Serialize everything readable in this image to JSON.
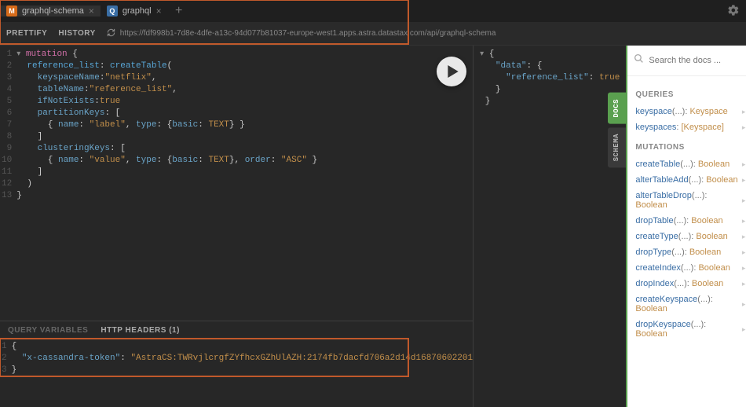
{
  "tabs": [
    {
      "label": "graphql-schema",
      "badge": "M",
      "active": true
    },
    {
      "label": "graphql",
      "badge": "Q",
      "active": false
    }
  ],
  "gear_icon": "gear",
  "toolbar": {
    "prettify": "PRETTIFY",
    "history": "HISTORY",
    "url": "https://fdf998b1-7d8e-4dfe-a13c-94d077b81037-europe-west1.apps.astra.datastax.com/api/graphql-schema"
  },
  "editor": {
    "lines": [
      {
        "n": 1,
        "html": "<span class='caret'>▾</span> <span class='kw'>mutation</span> {"
      },
      {
        "n": 2,
        "html": "  <span class='field'>reference_list</span>: <span class='field'>createTable</span>("
      },
      {
        "n": 3,
        "html": "    <span class='prop'>keyspaceName</span>:<span class='str'>\"netflix\"</span>,"
      },
      {
        "n": 4,
        "html": "    <span class='prop'>tableName</span>:<span class='str'>\"reference_list\"</span>,"
      },
      {
        "n": 5,
        "html": "    <span class='prop'>ifNotExists</span>:<span class='bool'>true</span>"
      },
      {
        "n": 6,
        "html": "    <span class='prop'>partitionKeys</span>: ["
      },
      {
        "n": 7,
        "html": "      { <span class='prop'>name</span>: <span class='str'>\"label\"</span>, <span class='prop'>type</span>: {<span class='prop'>basic</span>: <span class='enum'>TEXT</span>} }"
      },
      {
        "n": 8,
        "html": "    ]"
      },
      {
        "n": 9,
        "html": "    <span class='prop'>clusteringKeys</span>: ["
      },
      {
        "n": 10,
        "html": "      { <span class='prop'>name</span>: <span class='str'>\"value\"</span>, <span class='prop'>type</span>: {<span class='prop'>basic</span>: <span class='enum'>TEXT</span>}, <span class='prop'>order</span>: <span class='str'>\"ASC\"</span> }"
      },
      {
        "n": 11,
        "html": "    ]"
      },
      {
        "n": 12,
        "html": "  )"
      },
      {
        "n": 13,
        "html": "}"
      }
    ]
  },
  "result": {
    "lines": [
      "<span class='caret'>▾</span> {",
      "   <span class='prop'>\"data\"</span>: {",
      "     <span class='prop'>\"reference_list\"</span>: <span class='bool'>true</span>",
      "   }",
      " }"
    ]
  },
  "vars": {
    "tab_query": "QUERY VARIABLES",
    "tab_headers": "HTTP HEADERS (1)",
    "lines": [
      {
        "n": 1,
        "html": "{"
      },
      {
        "n": 2,
        "html": "  <span class='prop'>\"x-cassandra-token\"</span>: <span class='str'>\"AstraCS:TWRvjlcrgfZYfhcxGZhUlAZH:2174fb7dacfd706a2d14d16870602201</span>"
      },
      {
        "n": 3,
        "html": "}"
      }
    ]
  },
  "side": {
    "docs": "DOCS",
    "schema": "SCHEMA"
  },
  "docs": {
    "search_placeholder": "Search the docs ...",
    "sections": [
      {
        "title": "QUERIES",
        "items": [
          {
            "name": "keyspace",
            "args": "(...)",
            "type": "Keyspace"
          },
          {
            "name": "keyspaces",
            "args": "",
            "type": "[Keyspace]"
          }
        ]
      },
      {
        "title": "MUTATIONS",
        "items": [
          {
            "name": "createTable",
            "args": "(...)",
            "type": "Boolean"
          },
          {
            "name": "alterTableAdd",
            "args": "(...)",
            "type": "Boolean"
          },
          {
            "name": "alterTableDrop",
            "args": "(...)",
            "type": "Boolean"
          },
          {
            "name": "dropTable",
            "args": "(...)",
            "type": "Boolean"
          },
          {
            "name": "createType",
            "args": "(...)",
            "type": "Boolean"
          },
          {
            "name": "dropType",
            "args": "(...)",
            "type": "Boolean"
          },
          {
            "name": "createIndex",
            "args": "(...)",
            "type": "Boolean"
          },
          {
            "name": "dropIndex",
            "args": "(...)",
            "type": "Boolean"
          },
          {
            "name": "createKeyspace",
            "args": "(...)",
            "type": "Boolean"
          },
          {
            "name": "dropKeyspace",
            "args": "(...)",
            "type": "Boolean"
          }
        ]
      }
    ]
  }
}
